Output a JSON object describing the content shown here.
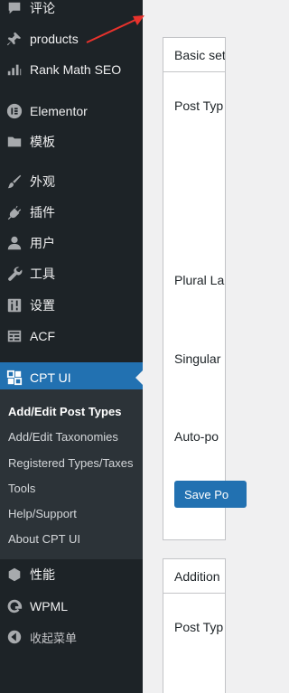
{
  "sidebar": {
    "items": [
      {
        "label": "评论",
        "icon": "comments-icon"
      },
      {
        "label": "products",
        "icon": "pin-icon"
      },
      {
        "label": "Rank Math SEO",
        "icon": "chart-icon"
      },
      {
        "label": "Elementor",
        "icon": "elementor-icon"
      },
      {
        "label": "模板",
        "icon": "folder-icon"
      },
      {
        "label": "外观",
        "icon": "paintbrush-icon"
      },
      {
        "label": "插件",
        "icon": "plug-icon"
      },
      {
        "label": "用户",
        "icon": "user-icon"
      },
      {
        "label": "工具",
        "icon": "wrench-icon"
      },
      {
        "label": "设置",
        "icon": "settings-sliders-icon"
      },
      {
        "label": "ACF",
        "icon": "table-icon"
      },
      {
        "label": "CPT UI",
        "icon": "grid-icon"
      }
    ],
    "submenu": [
      {
        "label": "Add/Edit Post Types"
      },
      {
        "label": "Add/Edit Taxonomies"
      },
      {
        "label": "Registered Types/Taxes"
      },
      {
        "label": "Tools"
      },
      {
        "label": "Help/Support"
      },
      {
        "label": "About CPT UI"
      }
    ],
    "bottom_items": [
      {
        "label": "性能",
        "icon": "performance-icon"
      },
      {
        "label": "WPML",
        "icon": "wpml-icon"
      },
      {
        "label": "收起菜单",
        "icon": "collapse-icon"
      }
    ]
  },
  "main": {
    "basic_settings_title": "Basic set",
    "labels": {
      "post_type": "Post Typ",
      "plural": "Plural La",
      "singular": "Singular",
      "auto": "Auto-po"
    },
    "save_button": "Save Po",
    "additional_title": "Addition",
    "additional_post_type": "Post Typ"
  },
  "colors": {
    "sidebar_bg": "#1d2327",
    "submenu_bg": "#2c3338",
    "accent": "#2271b1",
    "annotation_arrow": "#e8322c"
  }
}
